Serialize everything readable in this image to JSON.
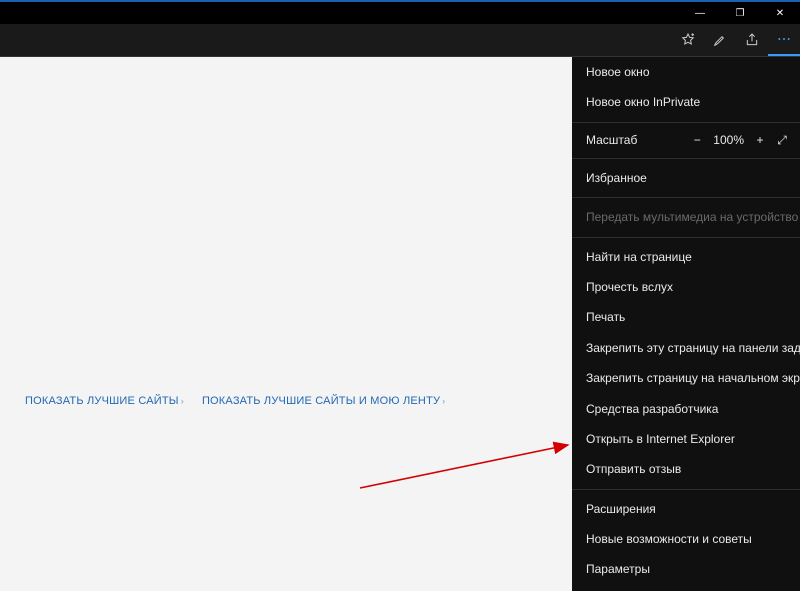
{
  "window": {
    "minimize_glyph": "—",
    "maximize_glyph": "❐",
    "close_glyph": "✕"
  },
  "toolbar": {
    "fav_icon": "favorites-star-icon",
    "notes_icon": "pen-icon",
    "share_icon": "share-icon",
    "more_icon": "more-icon"
  },
  "newtab": {
    "link_top": "ПОКАЗАТЬ ЛУЧШИЕ САЙТЫ",
    "link_feed": "ПОКАЗАТЬ ЛУЧШИЕ САЙТЫ И МОЮ ЛЕНТУ",
    "chevron": "›"
  },
  "menu": {
    "new_window": "Новое окно",
    "new_inprivate": "Новое окно InPrivate",
    "zoom_label": "Масштаб",
    "zoom_value": "100%",
    "minus": "−",
    "plus": "+",
    "fullscreen": "⤢",
    "favorites": "Избранное",
    "cast": "Передать мультимедиа на устройство",
    "find": "Найти на странице",
    "read_aloud": "Прочесть вслух",
    "print": "Печать",
    "pin_taskbar": "Закрепить эту страницу на панели задач",
    "pin_start": "Закрепить страницу на начальном экране",
    "dev_tools": "Средства разработчика",
    "open_ie": "Открыть в Internet Explorer",
    "feedback": "Отправить отзыв",
    "extensions": "Расширения",
    "whatsnew": "Новые возможности и советы",
    "settings": "Параметры"
  }
}
